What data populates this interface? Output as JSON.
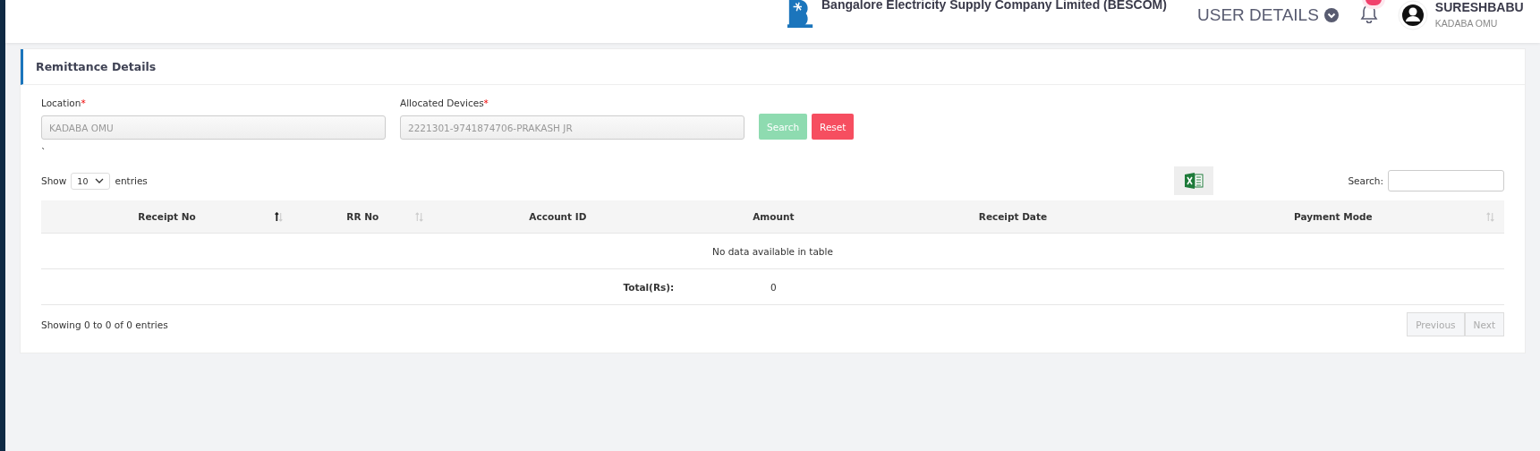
{
  "header": {
    "company": "Bangalore Electricity Supply Company Limited (BESCOM)",
    "user_details": "USER DETAILS",
    "user_name": "SURESHBABU",
    "user_location": "KADABA OMU"
  },
  "card": {
    "title": "Remittance Details",
    "fields": [
      {
        "label": "Location",
        "required_mark": "*",
        "value": "KADABA OMU"
      },
      {
        "label": "Allocated Devices",
        "required_mark": "*",
        "value": "2221301-9741874706-PRAKASH JR"
      }
    ],
    "buttons": [
      {
        "label": "Search",
        "kind": "primary",
        "disabled": true
      },
      {
        "label": "Reset",
        "kind": "danger",
        "disabled": false
      }
    ],
    "stray_mark": "`",
    "length": {
      "show": "Show",
      "value": "10",
      "entries": "entries"
    },
    "search_label": "Search:",
    "table": {
      "columns": [
        {
          "label": "Receipt No",
          "sortable": true,
          "sorted": true
        },
        {
          "label": "RR No",
          "sortable": true,
          "sorted": false
        },
        {
          "label": "Account ID",
          "sortable": false
        },
        {
          "label": "Amount",
          "sortable": false
        },
        {
          "label": "Receipt Date",
          "sortable": false
        },
        {
          "label": "Payment Mode",
          "sortable": true,
          "sorted": false
        }
      ],
      "empty": "No data available in table",
      "total_label": "Total(Rs):",
      "total_value": "0"
    },
    "info": "Showing 0 to 0 of 0 entries",
    "pager": [
      {
        "label": "Previous",
        "disabled": true
      },
      {
        "label": "Next",
        "disabled": true
      }
    ]
  }
}
